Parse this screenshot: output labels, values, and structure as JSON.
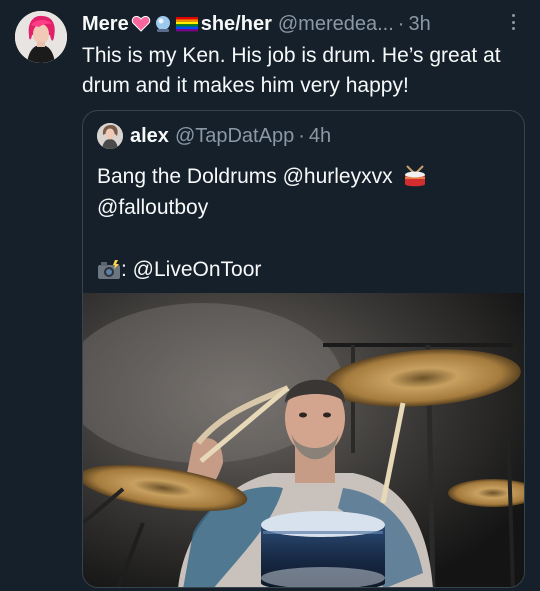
{
  "tweet": {
    "display_name": "Mere",
    "pronouns": "she/her",
    "handle": "@meredea...",
    "separator": "·",
    "time": "3h",
    "text": "This is my Ken. His job is drum. He’s great at drum and it makes him very happy!",
    "name_emojis": [
      "pink-heart-icon",
      "crystal-ball-icon",
      "rainbow-flag-icon"
    ]
  },
  "quote": {
    "display_name": "alex",
    "handle": "@TapDatApp",
    "separator": "·",
    "time": "4h",
    "line1": "Bang the Doldrums @hurleyxvx",
    "line2": "@falloutboy",
    "line3_suffix": ": @LiveOnToor",
    "media_alt": "drummer playing drum kit on stage"
  },
  "colors": {
    "background": "#15202b",
    "text": "#f7f9f9",
    "muted": "#8b98a5",
    "border": "#38444d"
  }
}
